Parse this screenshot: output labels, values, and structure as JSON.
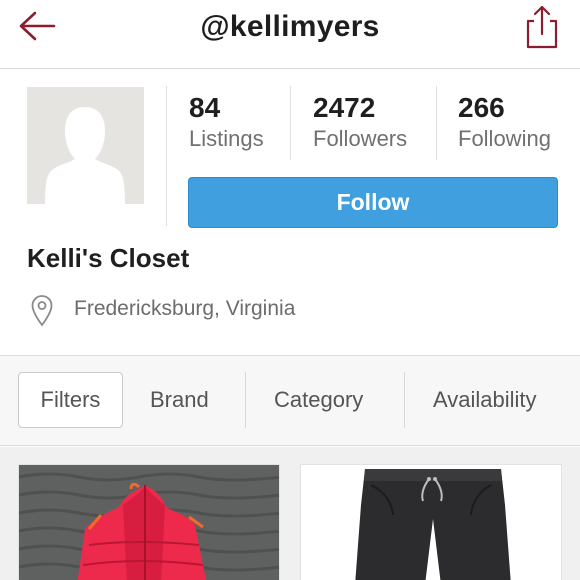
{
  "header": {
    "title": "@kellimyers"
  },
  "profile": {
    "stats": [
      {
        "value": "84",
        "label": "Listings"
      },
      {
        "value": "2472",
        "label": "Followers"
      },
      {
        "value": "266",
        "label": "Following"
      }
    ],
    "follow_label": "Follow",
    "closet_name": "Kelli's Closet",
    "location": "Fredericksburg, Virginia"
  },
  "filters": {
    "items": [
      "Filters",
      "Brand",
      "Category",
      "Availability"
    ]
  },
  "listings": [
    {
      "item": "red puffer vest"
    },
    {
      "item": "black pants"
    }
  ],
  "colors": {
    "accent_red": "#8c1d2e",
    "follow_blue": "#3f9fdf"
  }
}
